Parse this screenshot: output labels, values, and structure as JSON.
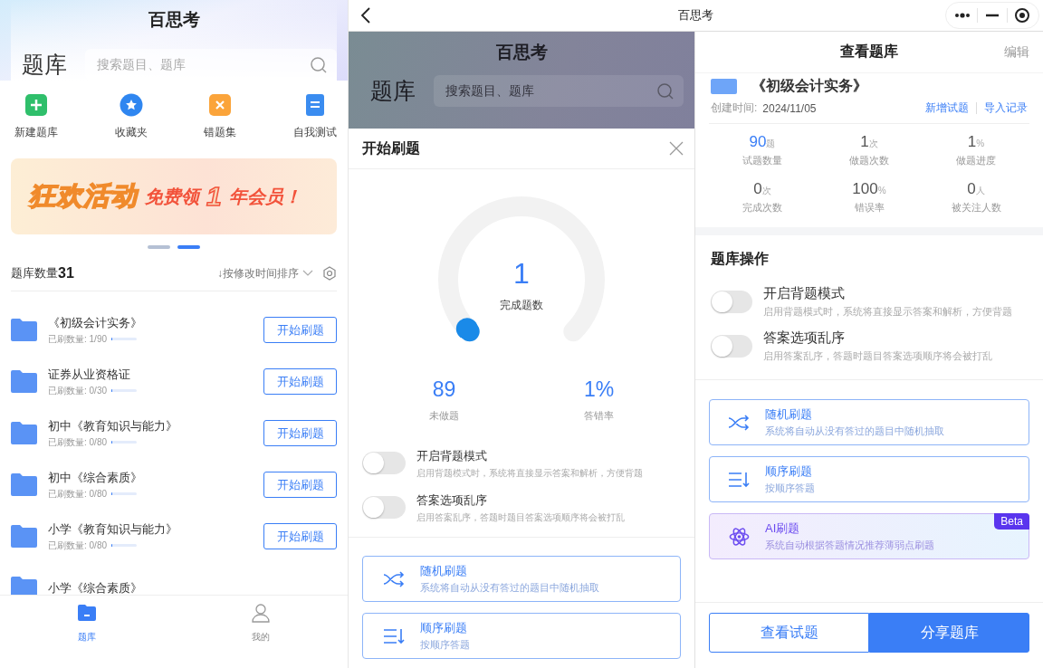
{
  "top_bar": {
    "title": "百思考"
  },
  "home": {
    "title": "百思考",
    "heading": "题库",
    "search": {
      "placeholder": "搜索题目、题库"
    },
    "shortcuts": [
      {
        "label": "新建题库",
        "kind": "new"
      },
      {
        "label": "收藏夹",
        "kind": "favorites"
      },
      {
        "label": "错题集",
        "kind": "mistakes"
      },
      {
        "label": "自我测试",
        "kind": "test"
      }
    ],
    "banner": {
      "headline": "狂欢活动",
      "offer": "免费领",
      "number": "1",
      "offer_end": "年会员！"
    },
    "carousel_dots": [
      {
        "selected": false
      },
      {
        "selected": true
      }
    ],
    "count_label": "题库数量",
    "count": "31",
    "sort": "↓按修改时间排序",
    "banks": [
      {
        "name": "《初级会计实务》",
        "progress": "已刷数量: 1/90",
        "level": 0.011,
        "action": "开始刷题"
      },
      {
        "name": "证券从业资格证",
        "progress": "已刷数量: 0/30",
        "level": 0,
        "action": "开始刷题"
      },
      {
        "name": "初中《教育知识与能力》",
        "progress": "已刷数量: 0/80",
        "level": 0,
        "action": "开始刷题"
      },
      {
        "name": "初中《综合素质》",
        "progress": "已刷数量: 0/80",
        "level": 0,
        "action": "开始刷题"
      },
      {
        "name": "小学《教育知识与能力》",
        "progress": "已刷数量: 0/80",
        "level": 0,
        "action": "开始刷题"
      },
      {
        "name": "小学《综合素质》"
      }
    ],
    "nav": [
      {
        "label": "题库",
        "kind": "bank",
        "selected": true
      },
      {
        "label": "我的",
        "kind": "me",
        "selected": false
      }
    ]
  },
  "backdrop": {
    "title": "百思考",
    "heading": "题库",
    "search": {
      "placeholder": "搜索题目、题库"
    }
  },
  "practice_sheet": {
    "title": "开始刷题",
    "gauge": {
      "value": "1",
      "label": "完成题数",
      "level": 0.011
    },
    "stats": [
      {
        "value": "89",
        "label": "未做题"
      },
      {
        "value": "1%",
        "label": "答错率"
      }
    ],
    "toggles": [
      {
        "title": "开启背题模式",
        "description": "启用背题模式时，系统将直接显示答案和解析，方便背题",
        "on": false
      },
      {
        "title": "答案选项乱序",
        "description": "启用答案乱序，答题时题目答案选项顺序将会被打乱",
        "on": false
      }
    ],
    "modes": [
      {
        "kind": "random",
        "title": "随机刷题",
        "description": "系统将自动从没有答过的题目中随机抽取"
      },
      {
        "kind": "sequential",
        "title": "顺序刷题",
        "description": "按顺序答题"
      }
    ]
  },
  "bank_detail": {
    "title": "查看题库",
    "edit": "编辑",
    "name": "《初级会计实务》",
    "created_label": "创建时间:",
    "created": "2024/11/05",
    "links": [
      "新增试题",
      "导入记录"
    ],
    "stats": [
      {
        "value": "90",
        "unit": "题",
        "label": "试题数量",
        "highlight": true
      },
      {
        "value": "1",
        "unit": "次",
        "label": "做题次数",
        "highlight": false
      },
      {
        "value": "1",
        "unit": "%",
        "label": "做题进度",
        "highlight": false
      },
      {
        "value": "0",
        "unit": "次",
        "label": "完成次数",
        "highlight": false
      },
      {
        "value": "100",
        "unit": "%",
        "label": "错误率",
        "highlight": false
      },
      {
        "value": "0",
        "unit": "人",
        "label": "被关注人数",
        "highlight": false
      }
    ],
    "section_title": "题库操作",
    "toggles": [
      {
        "title": "开启背题模式",
        "description": "启用背题模式时，系统将直接显示答案和解析，方便背题",
        "on": false
      },
      {
        "title": "答案选项乱序",
        "description": "启用答案乱序，答题时题目答案选项顺序将会被打乱",
        "on": false
      }
    ],
    "modes": [
      {
        "kind": "random",
        "title": "随机刷题",
        "description": "系统将自动从没有答过的题目中随机抽取"
      },
      {
        "kind": "sequential",
        "title": "顺序刷题",
        "description": "按顺序答题"
      },
      {
        "kind": "ai",
        "title": "AI刷题",
        "description": "系统自动根据答题情况推荐薄弱点刷题",
        "badge": "Beta"
      }
    ],
    "buttons": [
      {
        "label": "查看试题",
        "kind": "outline"
      },
      {
        "label": "分享题库",
        "kind": "primary"
      }
    ]
  }
}
